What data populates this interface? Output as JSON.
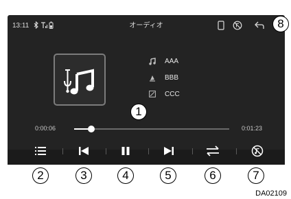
{
  "status_bar": {
    "time": "13:11",
    "title": "オーディオ",
    "icons": [
      "bluetooth-icon",
      "signal-icon",
      "battery-icon",
      "phone-icon",
      "no-music-icon",
      "back-arrow-icon"
    ]
  },
  "now_playing": {
    "album_art_icon": "usb-music-icon",
    "title": "AAA",
    "artist": "BBB",
    "album": "CCC",
    "elapsed": "0:00:06",
    "duration": "0:01:23",
    "progress": 0.07
  },
  "controls": [
    {
      "icon": "list-icon",
      "label_number": "2"
    },
    {
      "icon": "previous-track-icon",
      "label_number": "3"
    },
    {
      "icon": "pause-icon",
      "label_number": "4"
    },
    {
      "icon": "next-track-icon",
      "label_number": "5"
    },
    {
      "icon": "repeat-icon",
      "label_number": "6"
    },
    {
      "icon": "shuffle-off-icon",
      "label_number": "7"
    }
  ],
  "callouts": {
    "seek_bar": "1",
    "back_button": "8"
  },
  "figure_id": "DA02109",
  "colors": {
    "screen_bg": "#232323",
    "text": "#e6e6e6",
    "accent": "#ffffff"
  }
}
